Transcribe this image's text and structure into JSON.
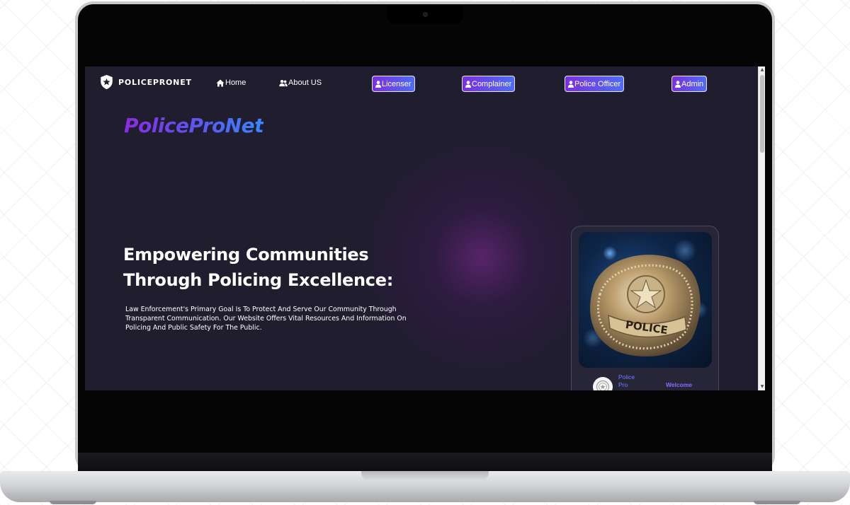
{
  "site": {
    "logo_text": "POLICEPRONET",
    "brand_title": "PoliceProNet"
  },
  "nav": {
    "home": "Home",
    "about": "About US"
  },
  "roles": {
    "licenser": "Licenser",
    "complainer": "Complainer",
    "police_officer": "Police Officer",
    "admin": "Admin"
  },
  "hero": {
    "headline_line1": "Empowering Communities",
    "headline_line2": "Through Policing Excellence:",
    "description": "Law Enforcement's Primary Goal Is To Protect And Serve Our Community Through Transparent Communication. Our Website Offers Vital Resources And Information On Policing And Public Safety For The Public."
  },
  "card": {
    "badge_text": "POLICE",
    "name_line1": "Police",
    "name_line2": "Pro",
    "welcome": "Welcome"
  },
  "colors": {
    "page_bg": "#201d2f",
    "accent_start": "#7b2fe0",
    "accent_end": "#4d6df5",
    "glow": "#78288c"
  },
  "icons": {
    "logo": "shield-star-icon",
    "home": "home-icon",
    "about": "users-icon",
    "role": "user-icon"
  }
}
